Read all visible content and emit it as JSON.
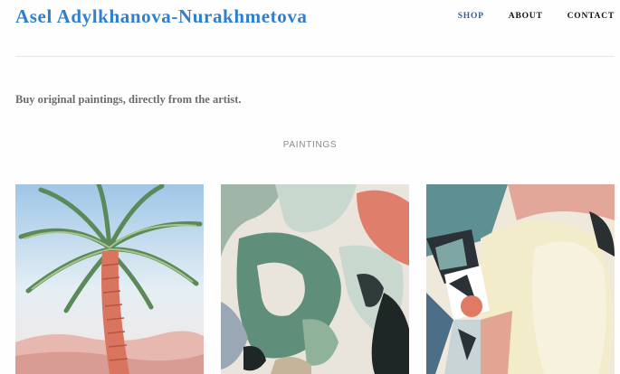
{
  "site": {
    "title": "Asel Adylkhanova-Nurakhmetova"
  },
  "nav": {
    "items": [
      {
        "label": "SHOP",
        "active": true
      },
      {
        "label": "ABOUT",
        "active": false
      },
      {
        "label": "CONTACT",
        "active": false
      }
    ]
  },
  "main": {
    "tagline": "Buy original paintings, directly from the artist.",
    "section_heading": "PAINTINGS"
  },
  "colors": {
    "title_blue": "#2f7fd0",
    "nav_active": "#2f5fa8"
  }
}
